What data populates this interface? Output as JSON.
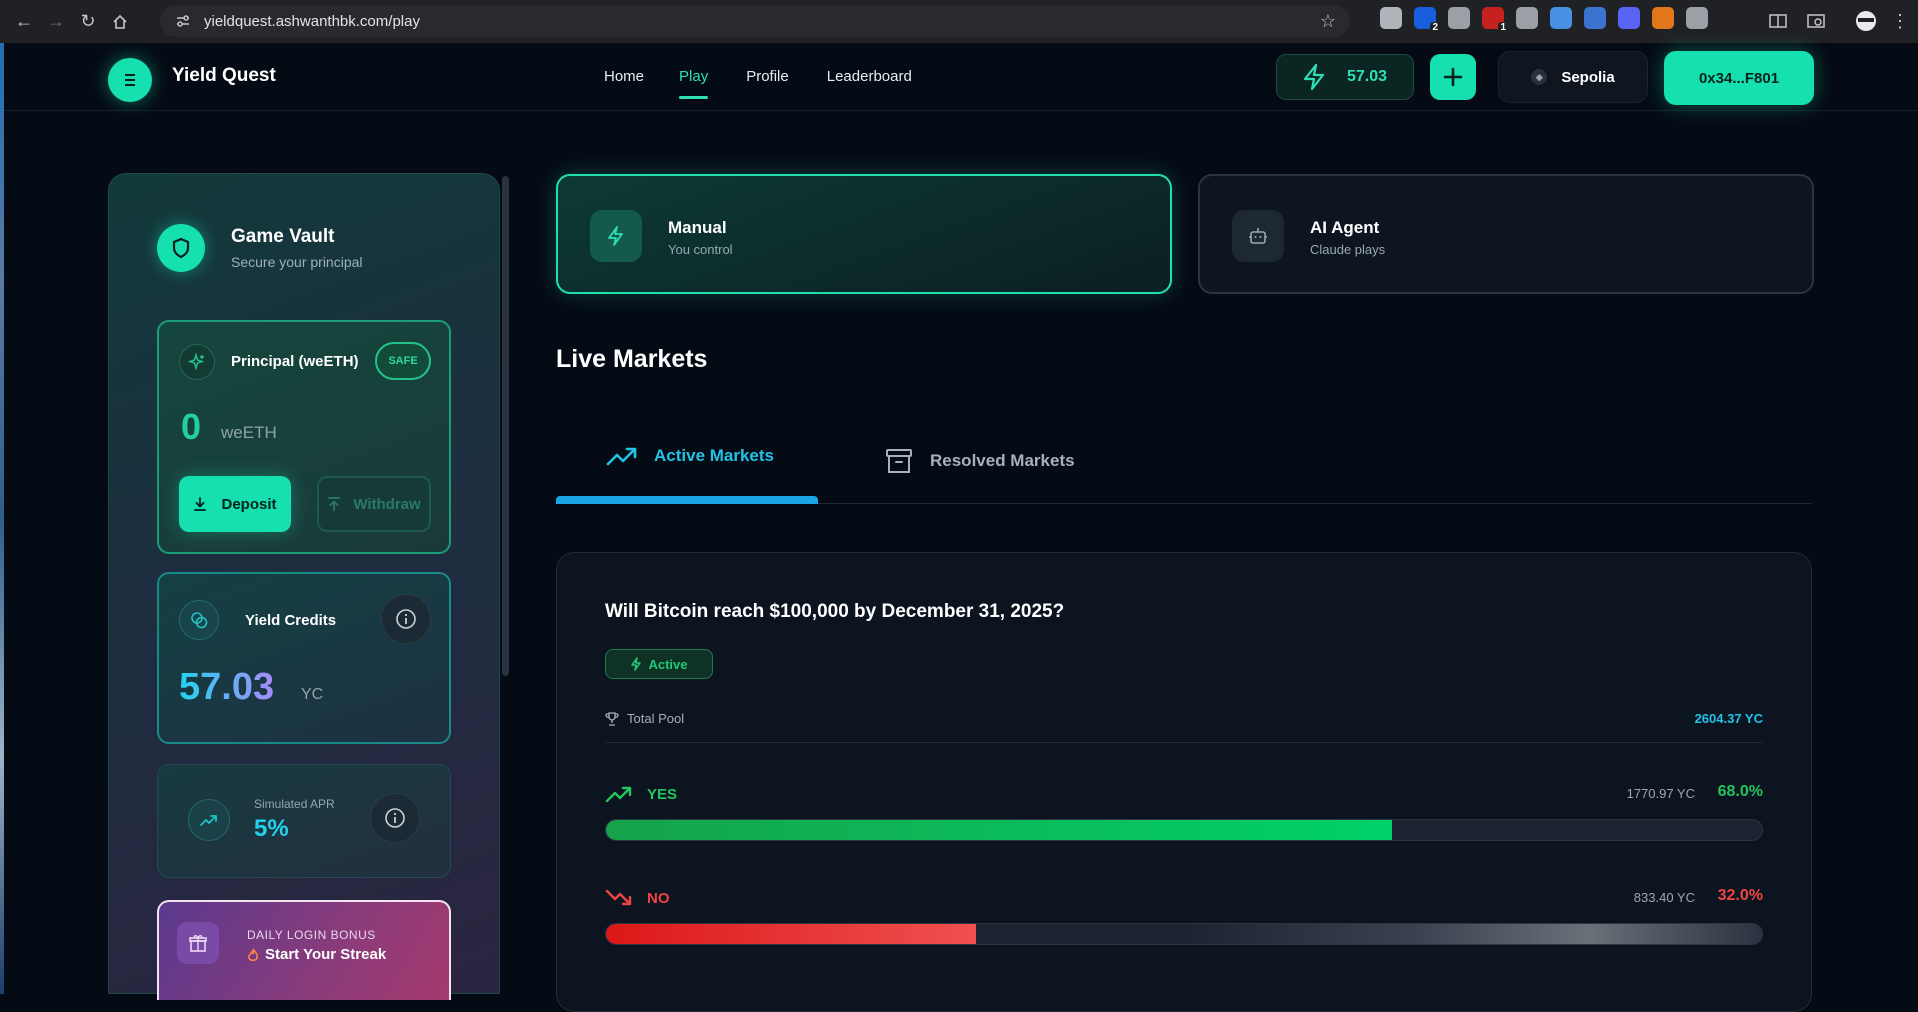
{
  "browser": {
    "url": "yieldquest.ashwanthbk.com/play",
    "extensions": [
      {
        "name": "profile-ext",
        "color": "#b0b4bb",
        "badge": ""
      },
      {
        "name": "bitwarden-ext",
        "color": "#175ddc",
        "badge": "2"
      },
      {
        "name": "feather-ext",
        "color": "#9aa0a6",
        "badge": ""
      },
      {
        "name": "red-ext",
        "color": "#c5221f",
        "badge": "1"
      },
      {
        "name": "slash-ext",
        "color": "#9aa0a6",
        "badge": ""
      },
      {
        "name": "bookmark-ext",
        "color": "#4a90e2",
        "badge": ""
      },
      {
        "name": "window-ext",
        "color": "#3b73d1",
        "badge": ""
      },
      {
        "name": "chat-ext",
        "color": "#5865f2",
        "badge": ""
      },
      {
        "name": "fox-ext",
        "color": "#e2761b",
        "badge": ""
      },
      {
        "name": "puzzle-ext",
        "color": "#9aa0a6",
        "badge": ""
      }
    ]
  },
  "nav": {
    "brand": "Yield Quest",
    "links": [
      {
        "label": "Home",
        "active": false
      },
      {
        "label": "Play",
        "active": true
      },
      {
        "label": "Profile",
        "active": false
      },
      {
        "label": "Leaderboard",
        "active": false
      }
    ],
    "credits": "57.03",
    "network": "Sepolia",
    "wallet": "0x34...F801"
  },
  "vault": {
    "title": "Game Vault",
    "subtitle": "Secure your principal",
    "principal": {
      "label": "Principal (weETH)",
      "badge": "SAFE",
      "amount": "0",
      "unit": "weETH",
      "deposit_label": "Deposit",
      "withdraw_label": "Withdraw"
    },
    "yield_credits": {
      "label": "Yield Credits",
      "amount": "57.03",
      "unit": "YC"
    },
    "apr": {
      "label": "Simulated APR",
      "value": "5%"
    },
    "bonus": {
      "label": "DAILY LOGIN BONUS",
      "title": "Start Your Streak"
    }
  },
  "modes": {
    "manual": {
      "title": "Manual",
      "subtitle": "You control"
    },
    "ai": {
      "title": "AI Agent",
      "subtitle": "Claude plays"
    }
  },
  "markets": {
    "heading": "Live Markets",
    "tabs": {
      "active": "Active Markets",
      "resolved": "Resolved Markets"
    },
    "card": {
      "question": "Will Bitcoin reach $100,000 by December 31, 2025?",
      "status": "Active",
      "pool_label": "Total Pool",
      "pool_value": "2604.37 YC",
      "yes": {
        "label": "YES",
        "amount": "1770.97 YC",
        "pct": "68.0%",
        "fraction": 0.68
      },
      "no": {
        "label": "NO",
        "amount": "833.40 YC",
        "pct": "32.0%",
        "fraction": 0.32
      }
    }
  },
  "colors": {
    "accent": "#16e0b0",
    "yes": "#22c55e",
    "no": "#ef4444",
    "tab_active": "#22c3e6"
  }
}
